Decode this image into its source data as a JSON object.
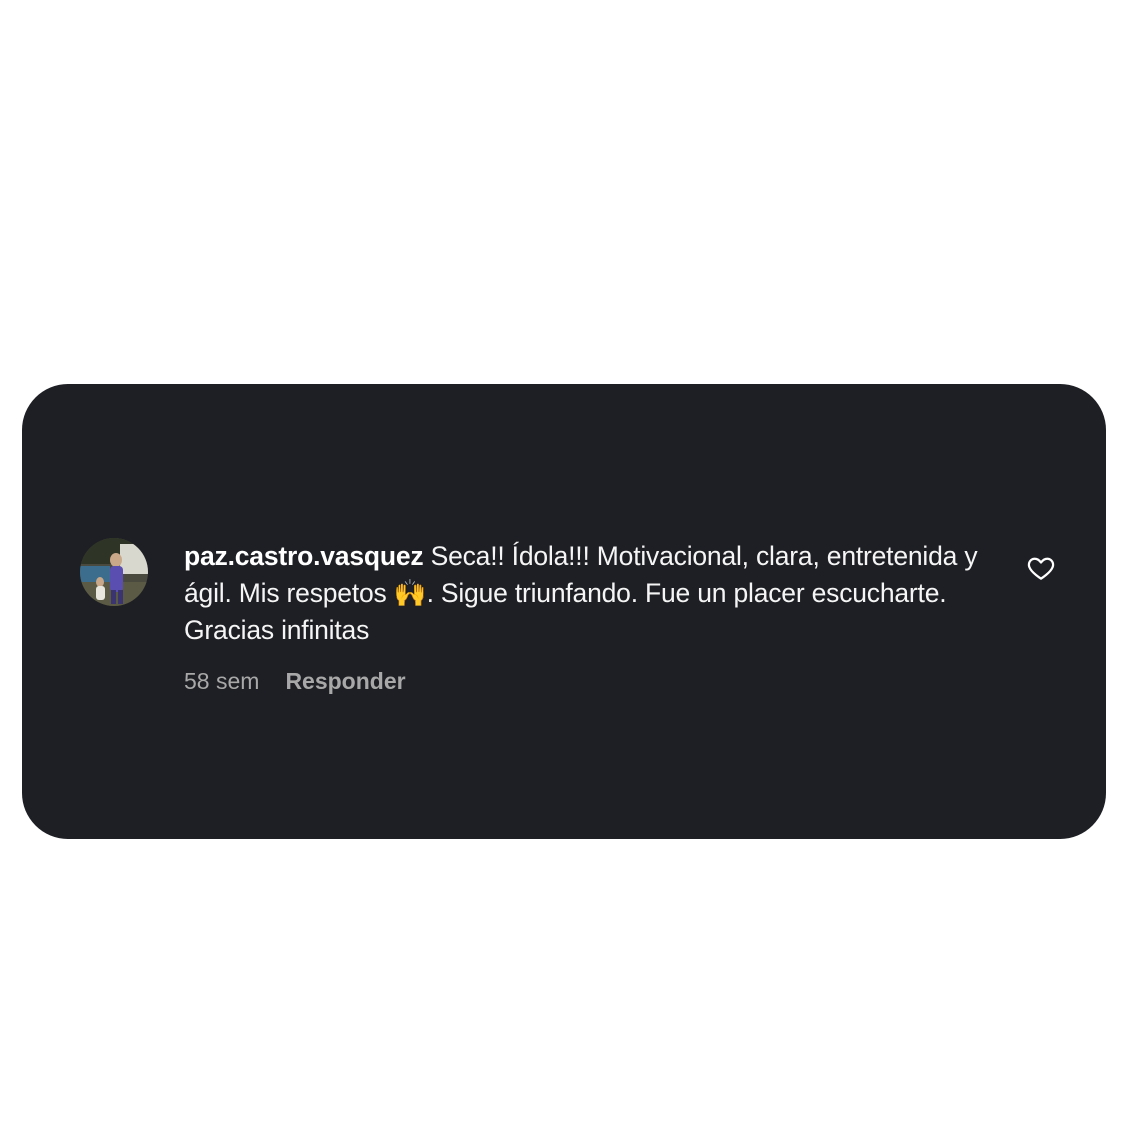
{
  "comment": {
    "username": "paz.castro.vasquez",
    "text_part1": "Seca!! Ídola!!! Motivacional, clara, entretenida y ágil. Mis respetos ",
    "emoji": "🙌",
    "text_part2": ". Sigue triunfando. Fue un placer escucharte. Gracias infinitas",
    "time": "58 sem",
    "reply_label": "Responder"
  },
  "icons": {
    "like": "heart-outline-icon",
    "avatar": "profile-photo"
  },
  "colors": {
    "card_background": "#1e1f24",
    "page_background": "#ffffff",
    "text": "#f5f5f5",
    "muted_text": "#a8a8a8"
  }
}
